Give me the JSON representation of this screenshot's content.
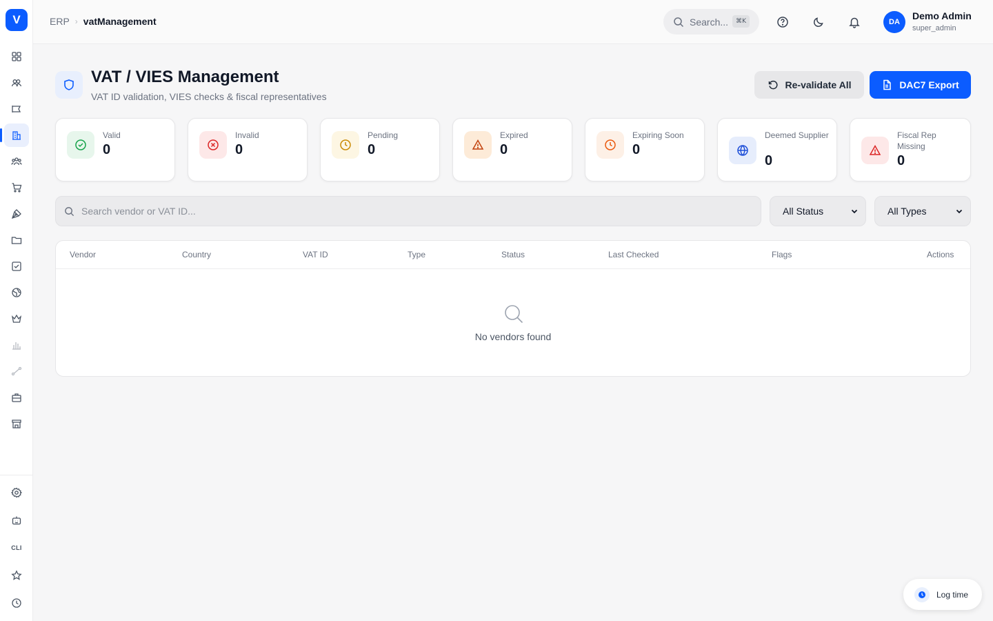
{
  "app": {
    "logo_letter": "V"
  },
  "breadcrumb": {
    "root": "ERP",
    "separator": "›",
    "current": "vatManagement"
  },
  "header": {
    "search_placeholder": "Search...",
    "search_shortcut": "⌘K",
    "user_initials": "DA",
    "user_name": "Demo Admin",
    "user_role": "super_admin"
  },
  "sidebar": {
    "cli_label": "CLI",
    "items": [
      {
        "icon": "grid-icon"
      },
      {
        "icon": "users-icon"
      },
      {
        "icon": "megaphone-icon"
      },
      {
        "icon": "building-icon",
        "active": true
      },
      {
        "icon": "team-icon"
      },
      {
        "icon": "cart-icon"
      },
      {
        "icon": "pen-tool-icon"
      },
      {
        "icon": "folder-icon"
      },
      {
        "icon": "checkbox-icon"
      },
      {
        "icon": "globe-icon"
      },
      {
        "icon": "crown-icon"
      },
      {
        "icon": "bar-chart-icon"
      },
      {
        "icon": "route-icon"
      },
      {
        "icon": "briefcase-icon"
      },
      {
        "icon": "store-icon"
      }
    ],
    "bottom_items": [
      {
        "icon": "settings-icon"
      },
      {
        "icon": "bot-icon"
      },
      {
        "icon": "cli-icon"
      },
      {
        "icon": "star-icon"
      },
      {
        "icon": "clock-icon"
      }
    ]
  },
  "page": {
    "title": "VAT / VIES Management",
    "subtitle": "VAT ID validation, VIES checks & fiscal representatives",
    "revalidate_label": "Re-validate All",
    "export_label": "DAC7 Export"
  },
  "stats": [
    {
      "label": "Valid",
      "value": "0",
      "icon": "check-circle-icon",
      "color": "#16a34a",
      "bg": "#e7f6ec"
    },
    {
      "label": "Invalid",
      "value": "0",
      "icon": "x-circle-icon",
      "color": "#dc2626",
      "bg": "#fde8e8"
    },
    {
      "label": "Pending",
      "value": "0",
      "icon": "clock-icon",
      "color": "#ca8a04",
      "bg": "#fdf6e3"
    },
    {
      "label": "Expired",
      "value": "0",
      "icon": "alert-triangle-icon",
      "color": "#c2410c",
      "bg": "#fdebd8"
    },
    {
      "label": "Expiring Soon",
      "value": "0",
      "icon": "clock-icon",
      "color": "#ea580c",
      "bg": "#fdf0e6"
    },
    {
      "label": "Deemed Supplier",
      "value": "0",
      "icon": "globe-icon",
      "color": "#1d4ed8",
      "bg": "#e6edfc"
    },
    {
      "label": "Fiscal Rep Missing",
      "value": "0",
      "icon": "alert-triangle-icon",
      "color": "#dc2626",
      "bg": "#fde8e8"
    }
  ],
  "filters": {
    "search_placeholder": "Search vendor or VAT ID...",
    "status_value": "All Status",
    "type_value": "All Types"
  },
  "table": {
    "columns": [
      "Vendor",
      "Country",
      "VAT ID",
      "Type",
      "Status",
      "Last Checked",
      "Flags",
      "Actions"
    ],
    "rows": [],
    "empty_text": "No vendors found"
  },
  "log_time_label": "Log time",
  "colors": {
    "accent": "#0b5cff"
  }
}
